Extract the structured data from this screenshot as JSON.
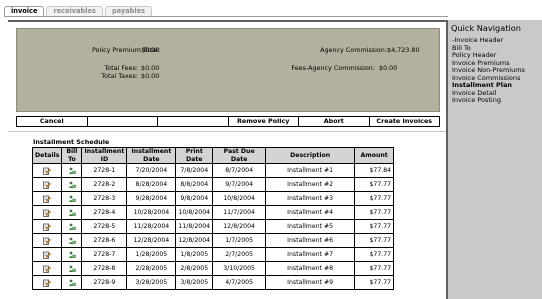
{
  "tabs": [
    {
      "label": "invoice",
      "active": true
    },
    {
      "label": "receivables",
      "active": false
    },
    {
      "label": "payables",
      "active": false
    }
  ],
  "summary": {
    "policy_premium_total_label": "Policy Premium Total:",
    "policy_premium_total_value": "$0.00",
    "agency_commission_label": "Agency Commission:",
    "agency_commission_value": "$4,723.80",
    "total_fees_label": "Total Fees:",
    "total_fees_value": "$0.00",
    "fees_agency_commission_label": "Fees-Agency Commission:",
    "fees_agency_commission_value": "$0.00",
    "total_taxes_label": "Total Taxes:",
    "total_taxes_value": "$0.00"
  },
  "buttons": {
    "cancel": "Cancel",
    "empty1": "",
    "empty2": "",
    "remove_policy": "Remove Policy",
    "abort": "Abort",
    "create_invoices": "Create Invoices"
  },
  "schedule": {
    "title": "Installment Schedule",
    "headers": [
      "Details",
      "Bill To",
      "Installment ID",
      "Installment Date",
      "Print Date",
      "Past Due Date",
      "Description",
      "Amount"
    ],
    "rows": [
      [
        "2728-1",
        "7/20/2004",
        "7/8/2004",
        "8/7/2004",
        "Installment #1",
        "$77.84"
      ],
      [
        "2728-2",
        "8/28/2004",
        "8/8/2004",
        "9/7/2004",
        "Installment #2",
        "$77.77"
      ],
      [
        "2728-3",
        "9/28/2004",
        "9/8/2004",
        "10/8/2004",
        "Installment #3",
        "$77.77"
      ],
      [
        "2728-4",
        "10/28/2004",
        "10/8/2004",
        "11/7/2004",
        "Installment #4",
        "$77.77"
      ],
      [
        "2728-5",
        "11/28/2004",
        "11/8/2004",
        "12/8/2004",
        "Installment #5",
        "$77.77"
      ],
      [
        "2728-6",
        "12/28/2004",
        "12/8/2004",
        "1/7/2005",
        "Installment #6",
        "$77.77"
      ],
      [
        "2728-7",
        "1/28/2005",
        "1/8/2005",
        "2/7/2005",
        "Installment #7",
        "$77.77"
      ],
      [
        "2728-8",
        "2/28/2005",
        "2/8/2005",
        "3/10/2005",
        "Installment #8",
        "$77.77"
      ],
      [
        "2728-9",
        "3/28/2005",
        "3/8/2005",
        "4/7/2005",
        "Installment #9",
        "$77.77"
      ]
    ]
  },
  "nav": {
    "title": "Quick Navigation",
    "items": [
      {
        "label": "-Invoice Header",
        "bold": false
      },
      {
        "label": "Bill To",
        "bold": false
      },
      {
        "label": "Policy Header",
        "bold": false
      },
      {
        "label": "Invoice Premiums",
        "bold": false
      },
      {
        "label": "Invoice Non-Premiums",
        "bold": false
      },
      {
        "label": "Invoice Commissions",
        "bold": false
      },
      {
        "label": "Installment Plan",
        "bold": true
      },
      {
        "label": "Invoice Detail",
        "bold": false
      },
      {
        "label": "Invoice Posting",
        "bold": false
      }
    ]
  },
  "icons": {
    "details": "edit-note-icon",
    "bill_to": "person-money-icon"
  }
}
